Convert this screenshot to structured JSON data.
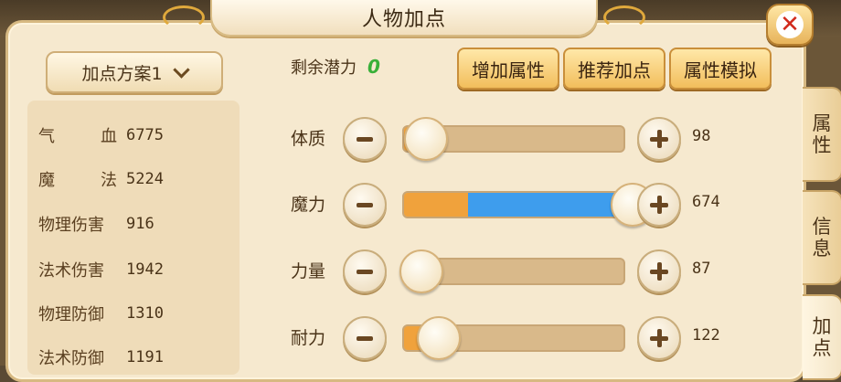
{
  "window": {
    "title": "人物加点",
    "close_label": "✕"
  },
  "plan_selector": {
    "label": "加点方案1"
  },
  "stats": [
    {
      "name": "气血",
      "value": "6775",
      "spread": true
    },
    {
      "name": "魔法",
      "value": "5224",
      "spread": true
    },
    {
      "name": "物理伤害",
      "value": "916",
      "spread": false
    },
    {
      "name": "法术伤害",
      "value": "1942",
      "spread": false
    },
    {
      "name": "物理防御",
      "value": "1310",
      "spread": false
    },
    {
      "name": "法术防御",
      "value": "1191",
      "spread": false
    }
  ],
  "remaining": {
    "label": "剩余潜力",
    "value": "0"
  },
  "buttons": {
    "add_attr": "增加属性",
    "recommend": "推荐加点",
    "simulate": "属性模拟"
  },
  "attributes": [
    {
      "name": "体质",
      "value": "98",
      "slider_fraction": 0.05
    },
    {
      "name": "魔力",
      "value": "674",
      "slider_fraction": 1.0
    },
    {
      "name": "力量",
      "value": "87",
      "slider_fraction": 0.03
    },
    {
      "name": "耐力",
      "value": "122",
      "slider_fraction": 0.11
    }
  ],
  "side_tabs": [
    {
      "label": "属性",
      "active": false
    },
    {
      "label": "信息",
      "active": false
    },
    {
      "label": "加点",
      "active": true
    }
  ],
  "colors": {
    "accent_orange": "#f0a23c",
    "accent_blue": "#3e9ded",
    "remaining_green": "#39b039",
    "close_red": "#d12a1c"
  }
}
